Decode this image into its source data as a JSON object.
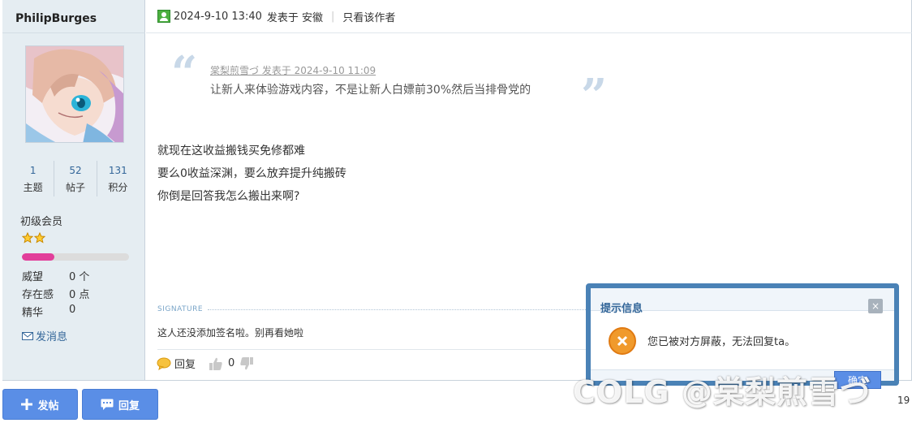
{
  "user": {
    "name": "PhilipBurges",
    "stats": [
      {
        "value": "1",
        "label": "主题"
      },
      {
        "value": "52",
        "label": "帖子"
      },
      {
        "value": "131",
        "label": "积分"
      }
    ],
    "rank": "初级会员",
    "level_progress": 0.3,
    "attributes": [
      {
        "label": "威望",
        "value": "0 个"
      },
      {
        "label": "存在感",
        "value": "0 点"
      },
      {
        "label": "精华",
        "value": "0"
      }
    ],
    "send_message": "发消息"
  },
  "post": {
    "timestamp": "2024-9-10 13:40",
    "posted_from": "发表于 安徽",
    "only_author": "只看该作者",
    "quote": {
      "header": "棠梨煎雪づ 发表于 2024-9-10 11:09",
      "text": "让新人来体验游戏内容，不是让新人白嫖前30%然后当排骨党的"
    },
    "body": [
      "就现在这收益搬钱买免修都难",
      "要么0收益深渊，要么放弃提升纯搬砖",
      "你倒是回答我怎么搬出来啊?"
    ],
    "signature_label": "SIGNATURE",
    "signature": "这人还没添加签名啦。别再看她啦",
    "reply": "回复",
    "like_count": "0"
  },
  "buttons": {
    "new_post": "发帖",
    "reply": "回复"
  },
  "dialog": {
    "title": "提示信息",
    "close": "×",
    "message": "您已被对方屏蔽，无法回复ta。",
    "ok": "确定"
  },
  "watermark": "COLG @棠梨煎雪づ",
  "page_tail": "19",
  "colors": {
    "accent": "#5a8ee6",
    "sidebar_bg": "#e5edf2",
    "dialog_border": "#4a82b6",
    "progress": "#e23e9a"
  }
}
